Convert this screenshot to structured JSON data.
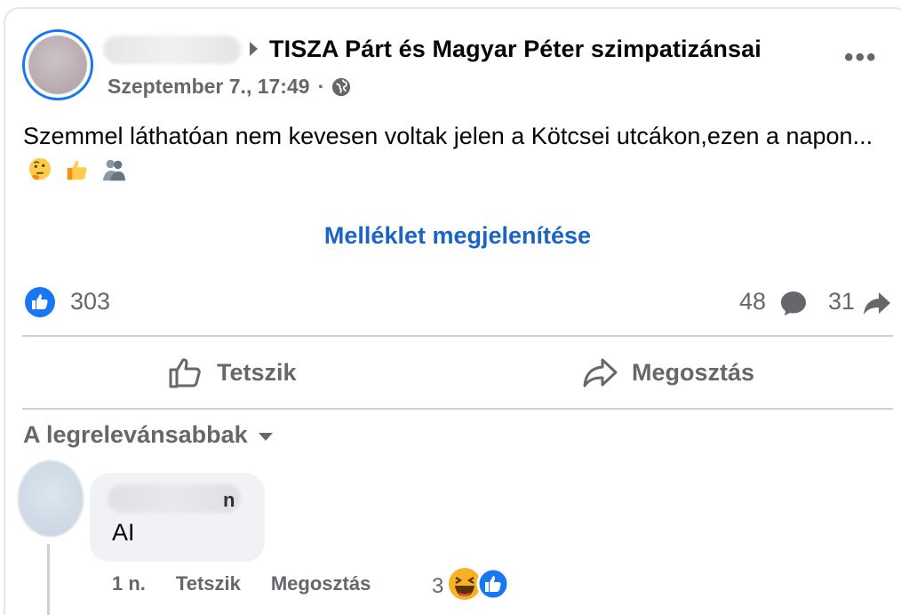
{
  "post": {
    "group_name": "TISZA Párt és Magyar Péter szimpatizánsai",
    "timestamp": "Szeptember 7., 17:49",
    "separator": "·",
    "audience_icon": "globe-icon",
    "more_icon": "more-dots-icon",
    "more_label": "•••",
    "text": "Szemmel láthatóan nem kevesen voltak jelen a Kötcsei utcákon,ezen a napon...",
    "emojis": [
      "thinking-face-icon",
      "thumbs-up-icon",
      "people-hugging-icon"
    ],
    "attachment_link": "Melléklet megjelenítése"
  },
  "stats": {
    "likes": "303",
    "comments": "48",
    "shares": "31"
  },
  "actions": {
    "like_label": "Tetszik",
    "share_label": "Megosztás"
  },
  "comments_section": {
    "sort_label": "A legrelevánsabbak",
    "comment": {
      "name_tail": "n",
      "text": "AI",
      "time": "1 n.",
      "like_label": "Tetszik",
      "share_label": "Megosztás",
      "reaction_count": "3"
    }
  },
  "colors": {
    "brand_blue": "#1877f2",
    "link_blue": "#1b64c4",
    "secondary_text": "#65676b",
    "divider": "#ced0d4",
    "bubble_bg": "#f0f2f5"
  }
}
